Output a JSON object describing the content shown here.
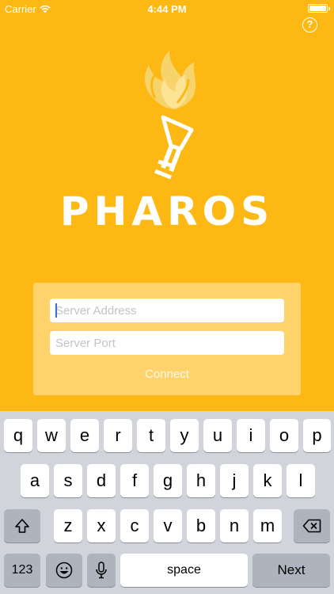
{
  "status_bar": {
    "carrier": "Carrier",
    "time": "4:44 PM"
  },
  "header": {
    "help_label": "?"
  },
  "brand": {
    "name": "PHAROS"
  },
  "form": {
    "server_address_placeholder": "Server Address",
    "server_address_value": "",
    "server_port_placeholder": "Server Port",
    "server_port_value": "",
    "connect_label": "Connect"
  },
  "keyboard": {
    "row1": [
      "q",
      "w",
      "e",
      "r",
      "t",
      "y",
      "u",
      "i",
      "o",
      "p"
    ],
    "row2": [
      "a",
      "s",
      "d",
      "f",
      "g",
      "h",
      "j",
      "k",
      "l"
    ],
    "row3": [
      "z",
      "x",
      "c",
      "v",
      "b",
      "n",
      "m"
    ],
    "numbers_label": "123",
    "space_label": "space",
    "next_label": "Next",
    "shift_icon": "shift-icon",
    "backspace_icon": "backspace-icon",
    "emoji_icon": "emoji-icon",
    "mic_icon": "microphone-icon"
  },
  "colors": {
    "brand": "#FDB813",
    "flame": "#F7D36B",
    "caret": "#3a6fd8"
  }
}
